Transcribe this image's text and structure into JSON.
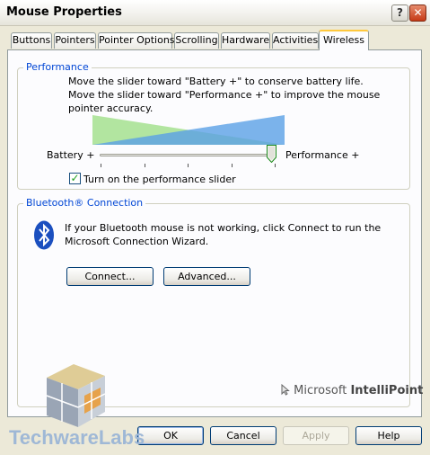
{
  "window": {
    "title": "Mouse Properties",
    "help_glyph": "?",
    "close_glyph": "✕"
  },
  "tabs": [
    {
      "label": "Buttons"
    },
    {
      "label": "Pointers"
    },
    {
      "label": "Pointer Options"
    },
    {
      "label": "Scrolling"
    },
    {
      "label": "Hardware"
    },
    {
      "label": "Activities"
    },
    {
      "label": "Wireless",
      "active": true
    }
  ],
  "performance": {
    "legend": "Performance",
    "description": "Move the slider toward \"Battery +\" to conserve battery life. Move the slider toward \"Performance +\" to improve the mouse pointer accuracy.",
    "battery_label": "Battery +",
    "performance_label": "Performance +",
    "slider_value": 1.0,
    "checkbox_checked": true,
    "checkbox_label": "Turn on the performance slider",
    "colors": {
      "battery": "#a5e08f",
      "performance": "#5aa0e6"
    }
  },
  "bluetooth": {
    "legend": "Bluetooth® Connection",
    "description": "If your Bluetooth mouse is not working, click Connect to run the Microsoft Connection Wizard.",
    "connect_label": "Connect...",
    "advanced_label": "Advanced..."
  },
  "branding": {
    "intellipoint_prefix": "Microsoft ",
    "intellipoint_name": "IntelliPoint",
    "watermark": "TechwareLabs"
  },
  "footer": {
    "ok": "OK",
    "cancel": "Cancel",
    "apply": "Apply",
    "help": "Help"
  },
  "icons": {
    "cursor": "cursor-icon",
    "bluetooth": "bluetooth-icon",
    "check": "✓"
  }
}
